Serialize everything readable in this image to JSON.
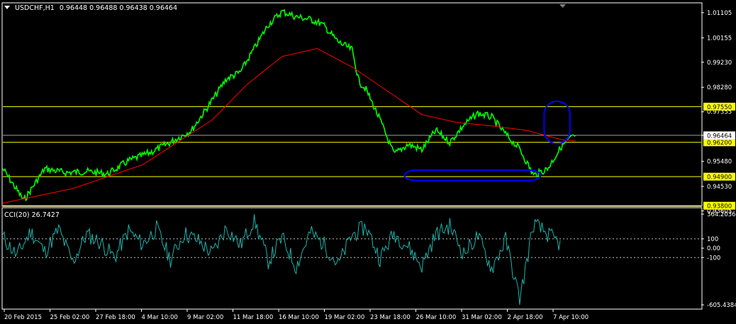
{
  "header": {
    "symbol_timeframe": "USDCHF,H1",
    "ohlc": "0.96448 0.96488 0.96438 0.96464"
  },
  "cci_header": {
    "label": "CCI(20) 26.7427"
  },
  "colors": {
    "background": "#000000",
    "price": "#00ff00",
    "moving_average": "#ff0000",
    "hline": "#ffff00",
    "cci": "#20b2aa",
    "highlight": "#0000ff",
    "axis": "#ffffff",
    "bid_line": "#a0a0a0"
  },
  "chart_data": [
    {
      "type": "line",
      "ylim": [
        0.93805,
        1.0145
      ],
      "price_axis_ticks": [
        "1.01105",
        "1.00155",
        "0.99230",
        "0.98280",
        "0.97355",
        "0.96464",
        "0.95480",
        "0.94530",
        "0.93605"
      ],
      "horizontal_levels": [
        {
          "value": 0.9755,
          "label": "0.97550"
        },
        {
          "value": 0.962,
          "label": "0.96200"
        },
        {
          "value": 0.949,
          "label": "0.94900"
        },
        {
          "value": 0.938,
          "label": "0.93800"
        }
      ],
      "current_price": {
        "value": 0.96464,
        "label": "0.96464"
      },
      "x_labels": [
        "20 Feb 2015",
        "25 Feb 02:00",
        "27 Feb 18:00",
        "4 Mar 10:00",
        "9 Mar 02:00",
        "11 Mar 18:00",
        "16 Mar 10:00",
        "19 Mar 02:00",
        "23 Mar 18:00",
        "26 Mar 10:00",
        "31 Mar 02:00",
        "2 Apr 18:00",
        "7 Apr 10:00"
      ],
      "series": [
        {
          "x": [
            0,
            0.03,
            0.06,
            0.09,
            0.12,
            0.15,
            0.18,
            0.21,
            0.24,
            0.27,
            0.3,
            0.32,
            0.34,
            0.36,
            0.38,
            0.4,
            0.42,
            0.44,
            0.455,
            0.46,
            0.48,
            0.5,
            0.51,
            0.52,
            0.54,
            0.56,
            0.58,
            0.6,
            0.62,
            0.64,
            0.66,
            0.68,
            0.7,
            0.72,
            0.74,
            0.76,
            0.78,
            0.8,
            0.81,
            0.82
          ],
          "values": [
            0.952,
            0.94,
            0.952,
            0.9505,
            0.951,
            0.95,
            0.955,
            0.958,
            0.962,
            0.9665,
            0.978,
            0.986,
            0.9885,
            0.9975,
            1.0065,
            1.0115,
            1.0095,
            1.0085,
            1.007,
            1.006,
            1.0,
            0.997,
            0.985,
            0.982,
            0.9705,
            0.9575,
            0.9612,
            0.9592,
            0.9665,
            0.962,
            0.9685,
            0.973,
            0.9715,
            0.965,
            0.9595,
            0.9495,
            0.952,
            0.9605,
            0.963,
            0.9646
          ]
        },
        {
          "x": [
            0,
            0.1,
            0.2,
            0.3,
            0.35,
            0.4,
            0.45,
            0.5,
            0.55,
            0.6,
            0.65,
            0.7,
            0.75,
            0.8,
            0.82
          ],
          "values": [
            0.939,
            0.9445,
            0.9535,
            0.9705,
            0.984,
            0.9945,
            0.9975,
            0.9905,
            0.9815,
            0.9725,
            0.9695,
            0.9682,
            0.9665,
            0.963,
            0.9625
          ]
        }
      ],
      "highlights": [
        {
          "x_range": [
            0.575,
            0.77
          ],
          "y_range": [
            0.9475,
            0.9515
          ]
        },
        {
          "x_range": [
            0.775,
            0.812
          ],
          "y_range": [
            0.9615,
            0.9775
          ]
        }
      ]
    },
    {
      "type": "line",
      "ylim": [
        -605.4384,
        364.2036
      ],
      "ticks": [
        "364.2036",
        "100",
        "0.00",
        "-100",
        "-605.4384"
      ],
      "levels": [
        100,
        -100
      ],
      "series": [
        {
          "x": [
            0,
            0.02,
            0.04,
            0.06,
            0.08,
            0.1,
            0.12,
            0.14,
            0.16,
            0.18,
            0.2,
            0.22,
            0.24,
            0.26,
            0.28,
            0.3,
            0.32,
            0.34,
            0.36,
            0.38,
            0.4,
            0.42,
            0.44,
            0.46,
            0.48,
            0.5,
            0.52,
            0.54,
            0.56,
            0.58,
            0.6,
            0.62,
            0.64,
            0.66,
            0.68,
            0.7,
            0.72,
            0.74,
            0.76,
            0.78,
            0.8
          ],
          "values": [
            120,
            -80,
            180,
            -40,
            200,
            -150,
            150,
            60,
            -100,
            190,
            40,
            210,
            -120,
            160,
            80,
            -60,
            220,
            30,
            300,
            -140,
            110,
            -200,
            170,
            40,
            -180,
            140,
            230,
            -110,
            160,
            20,
            -190,
            150,
            240,
            -60,
            130,
            -220,
            90,
            -550,
            260,
            150,
            30
          ]
        }
      ]
    }
  ]
}
